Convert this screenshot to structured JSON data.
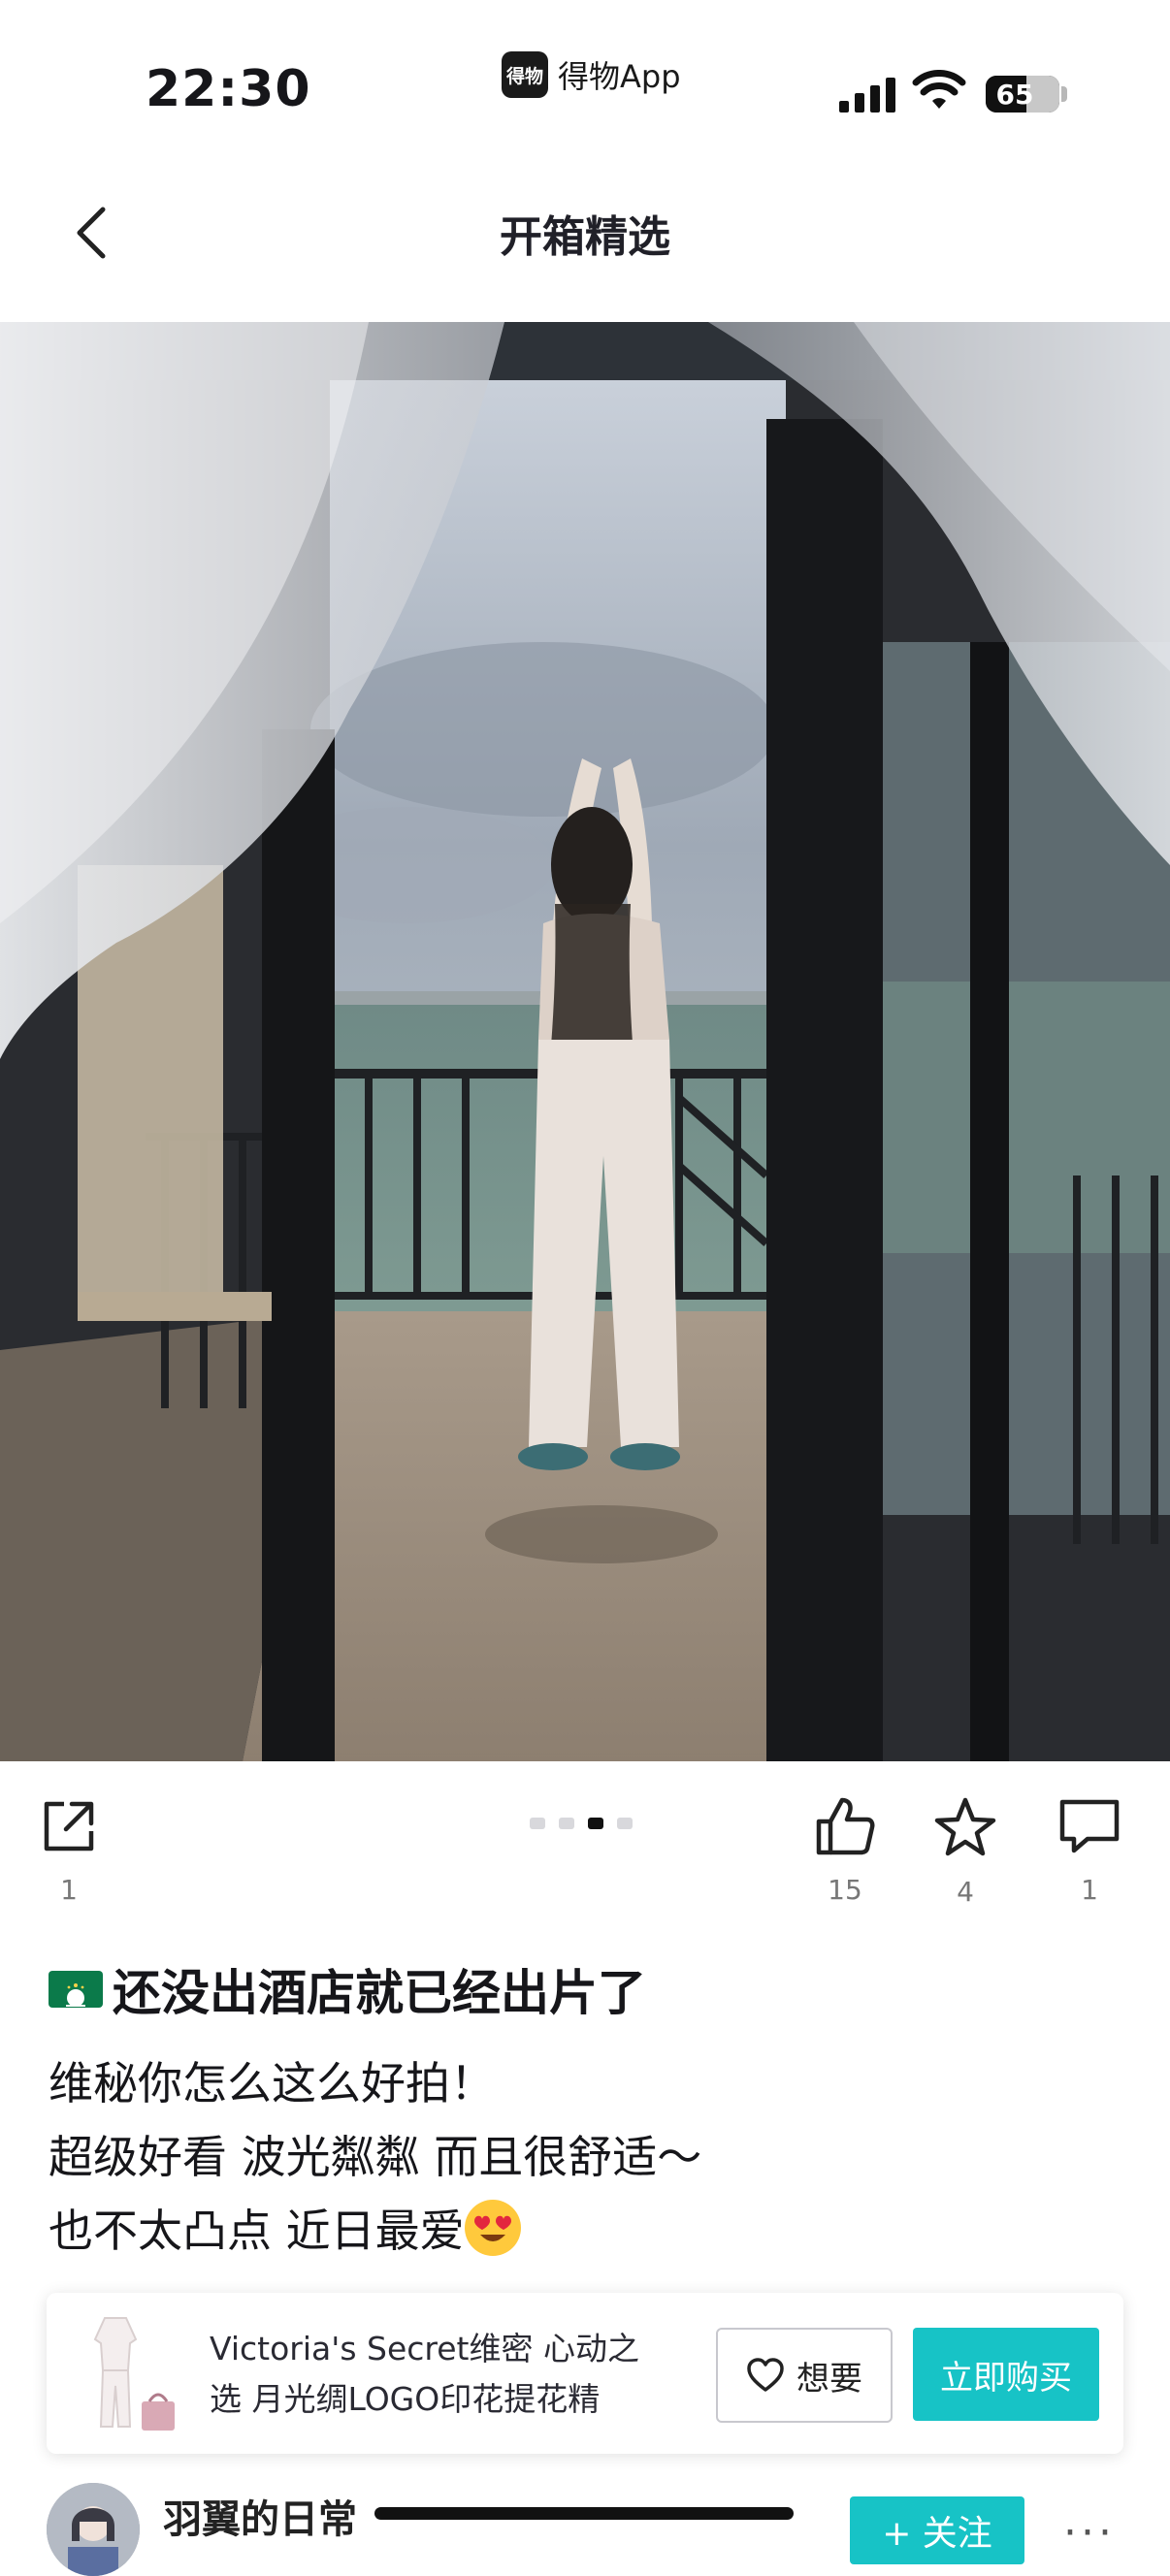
{
  "status_bar": {
    "time": "22:30",
    "app_logo_text": "得物",
    "app_name": "得物App",
    "battery": "65"
  },
  "nav": {
    "title": "开箱精选"
  },
  "actions": {
    "share_count": "1",
    "like_count": "15",
    "favorite_count": "4",
    "comment_count": "1"
  },
  "carousel": {
    "total": 4,
    "active_index": 2
  },
  "post": {
    "title": "还没出酒店就已经出片了",
    "lines": [
      "维秘你怎么这么好拍！",
      "超级好看 波光粼粼 而且很舒适～",
      "也不太凸点 近日最爱"
    ]
  },
  "product": {
    "name_line1": "Victoria's Secret维密 心动之",
    "name_line2": "选 月光绸LOGO印花提花精",
    "want_label": "想要",
    "buy_label": "立即购买"
  },
  "author": {
    "name": "羽翼的日常",
    "follow_label": "+ 关注",
    "more": "···"
  },
  "colors": {
    "accent": "#17c3c6",
    "text": "#16161a",
    "muted": "#777777"
  }
}
